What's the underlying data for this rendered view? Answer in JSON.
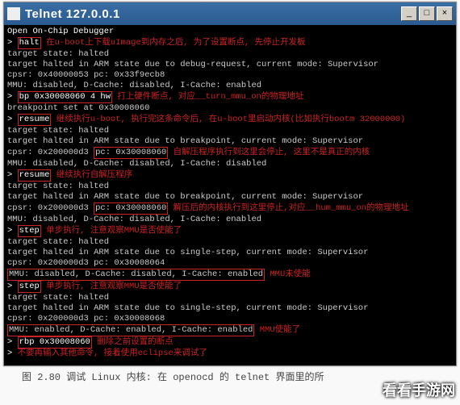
{
  "window": {
    "title": "Telnet 127.0.0.1",
    "min": "_",
    "max": "□",
    "close": "×"
  },
  "term": {
    "l01": "Open On-Chip Debugger",
    "l02a": "> ",
    "l02b": "halt",
    "l02c": " 在u-boot上下载uImage到内存之后, 为了设置断点, 先停止开发板",
    "l03": "target state: halted",
    "l04": "target halted in ARM state due to debug-request, current mode: Supervisor",
    "l05": "cpsr: 0x40000053 pc: 0x33f9ecb8",
    "l06": "MMU: disabled, D-Cache: disabled, I-Cache: enabled",
    "l07a": "> ",
    "l07b": "bp 0x30008060 4 hw",
    "l07c": " 打上硬件断点, 对应__turn_mmu_on的物理地址",
    "l08": "breakpoint set at 0x30008060",
    "l09a": "> ",
    "l09b": "resume",
    "l09c": " 继续执行u-boot, 执行完这条命令后, 在u-boot里启动内核(比如执行bootm 32000000)",
    "l10": "target state: halted",
    "l11": "target halted in ARM state due to breakpoint, current mode: Supervisor",
    "l12a": "cpsr: 0x200000d3 ",
    "l12b": "pc: 0x30008060",
    "l12c": " 自解压程序执行到这里会停止, 这里不是真正的内核",
    "l13": "MMU: disabled, D-Cache: disabled, I-Cache: disabled",
    "l14a": "> ",
    "l14b": "resume",
    "l14c": " 继续执行自解压程序",
    "l15": "target state: halted",
    "l16": "target halted in ARM state due to breakpoint, current mode: Supervisor",
    "l17a": "cpsr: 0x200000d3 ",
    "l17b": "pc: 0x30008060",
    "l17c": " 解压后的内核执行到这里停止,对应__hum_mmu_on的物理地址",
    "l18": "MMU: disabled, D-Cache: disabled, I-Cache: enabled",
    "l19a": "> ",
    "l19b": "step",
    "l19c": " 单步执行, 注意观察MMU是否使能了",
    "l20": "target state: halted",
    "l21": "target halted in ARM state due to single-step, current mode: Supervisor",
    "l22": "cpsr: 0x200000d3 pc: 0x30008064",
    "l23a": "MMU: disabled, D-Cache: disabled, I-Cache: enabled",
    "l23b": " MMU未使能",
    "l24a": "> ",
    "l24b": "step",
    "l24c": " 单步执行, 注意观察MMU是否使能了",
    "l25": "target state: halted",
    "l26": "target halted in ARM state due to single-step, current mode: Supervisor",
    "l27": "cpsr: 0x200000d3 pc: 0x30008068",
    "l28a": "MMU: enabled, D-Cache: enabled, I-Cache: enabled",
    "l28b": " MMU使能了",
    "l29a": "> ",
    "l29b": "rbp 0x30008060",
    "l29c": " 删除之前设置的断点",
    "l30a": "> ",
    "l30b": "不要再输入其他命令, 接着使用eclipse来调试了"
  },
  "caption": "图 2.80 调试 Linux 内核: 在 openocd 的 telnet 界面里的所",
  "watermark": "看看手游网"
}
